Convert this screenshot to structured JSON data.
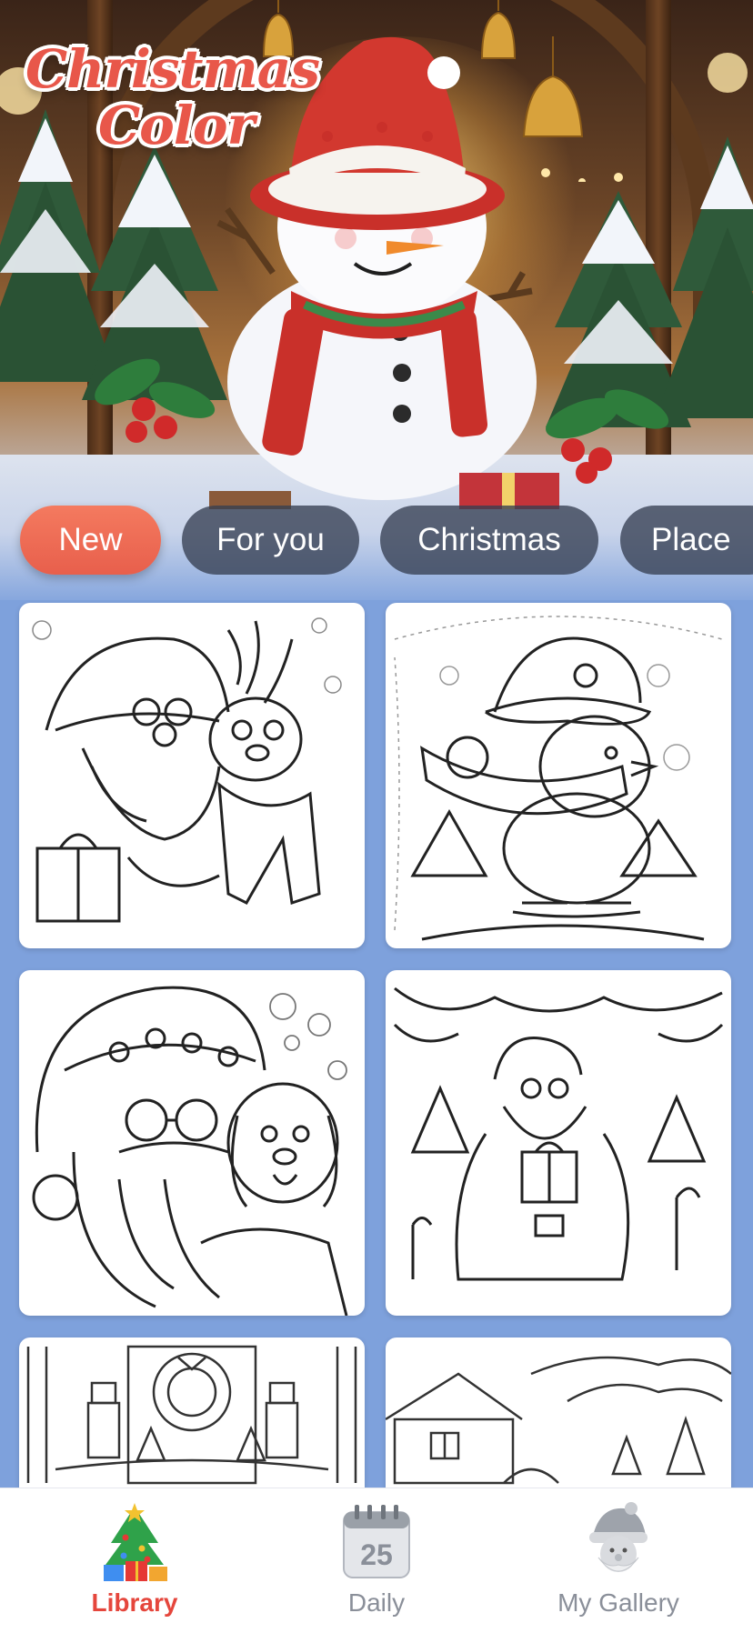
{
  "app": {
    "logo_line1": "Christmas",
    "logo_line2": "Color"
  },
  "tabs": [
    {
      "label": "New",
      "active": true
    },
    {
      "label": "For you",
      "active": false
    },
    {
      "label": "Christmas",
      "active": false
    },
    {
      "label": "Place",
      "active": false
    }
  ],
  "grid": {
    "cards": [
      {
        "subject": "santa-with-reindeer"
      },
      {
        "subject": "penguin-skating"
      },
      {
        "subject": "santa-with-puppy"
      },
      {
        "subject": "santa-holding-gift"
      },
      {
        "subject": "nutcrackers-door-wreath"
      },
      {
        "subject": "snowy-cabin"
      }
    ]
  },
  "bottom_nav": [
    {
      "label": "Library",
      "icon": "christmas-tree-icon",
      "active": true
    },
    {
      "label": "Daily",
      "icon": "calendar-icon",
      "active": false,
      "calendar_day": "25"
    },
    {
      "label": "My Gallery",
      "icon": "santa-icon",
      "active": false
    }
  ],
  "colors": {
    "accent": "#e85f4c",
    "active_nav": "#e5463c",
    "inactive_nav": "#8a8f99",
    "tab_bg": "#363f52",
    "page_bg": "#7ea1dc"
  }
}
